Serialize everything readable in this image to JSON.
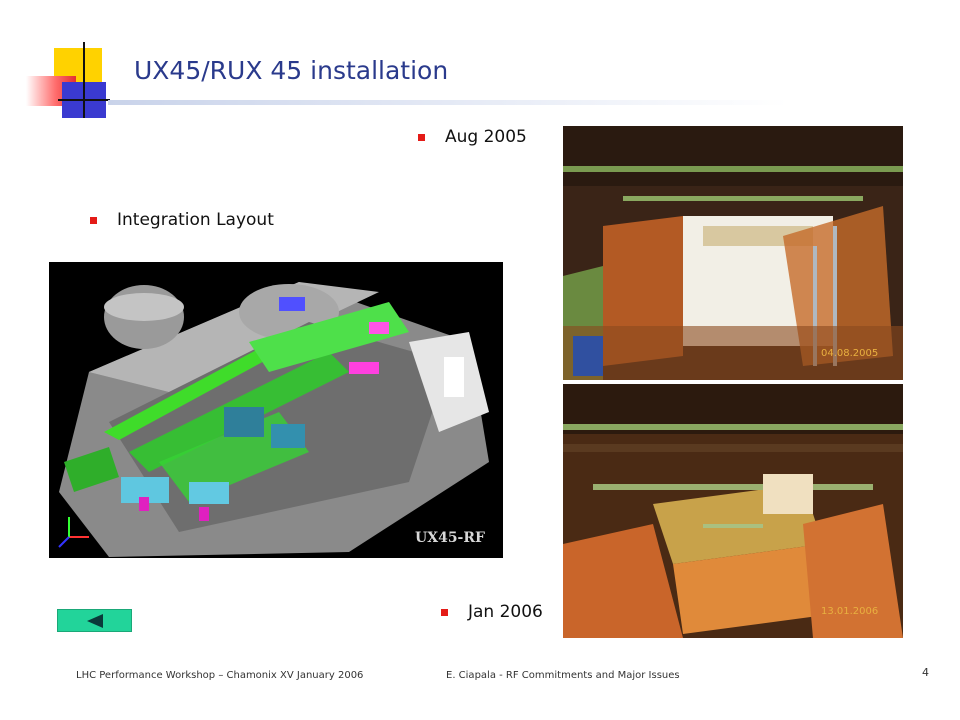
{
  "slide": {
    "title": "UX45/RUX 45 installation",
    "bullets": {
      "aug": "Aug 2005",
      "integration": "Integration Layout",
      "jan": "Jan 2006"
    },
    "images": {
      "layout_label": "UX45-RF",
      "photo_aug_date": "04.08.2005",
      "photo_jan_date": "13.01.2006"
    },
    "nav": {
      "back_icon": "back-arrow-icon"
    },
    "footer": {
      "left": "LHC Performance Workshop – Chamonix XV January 2006",
      "center": "E. Ciapala - RF Commitments and Major Issues",
      "page_number": "4"
    }
  },
  "colors": {
    "title": "#2a3a8c",
    "bullet": "#e41b17",
    "back_button": "#22d49a"
  }
}
